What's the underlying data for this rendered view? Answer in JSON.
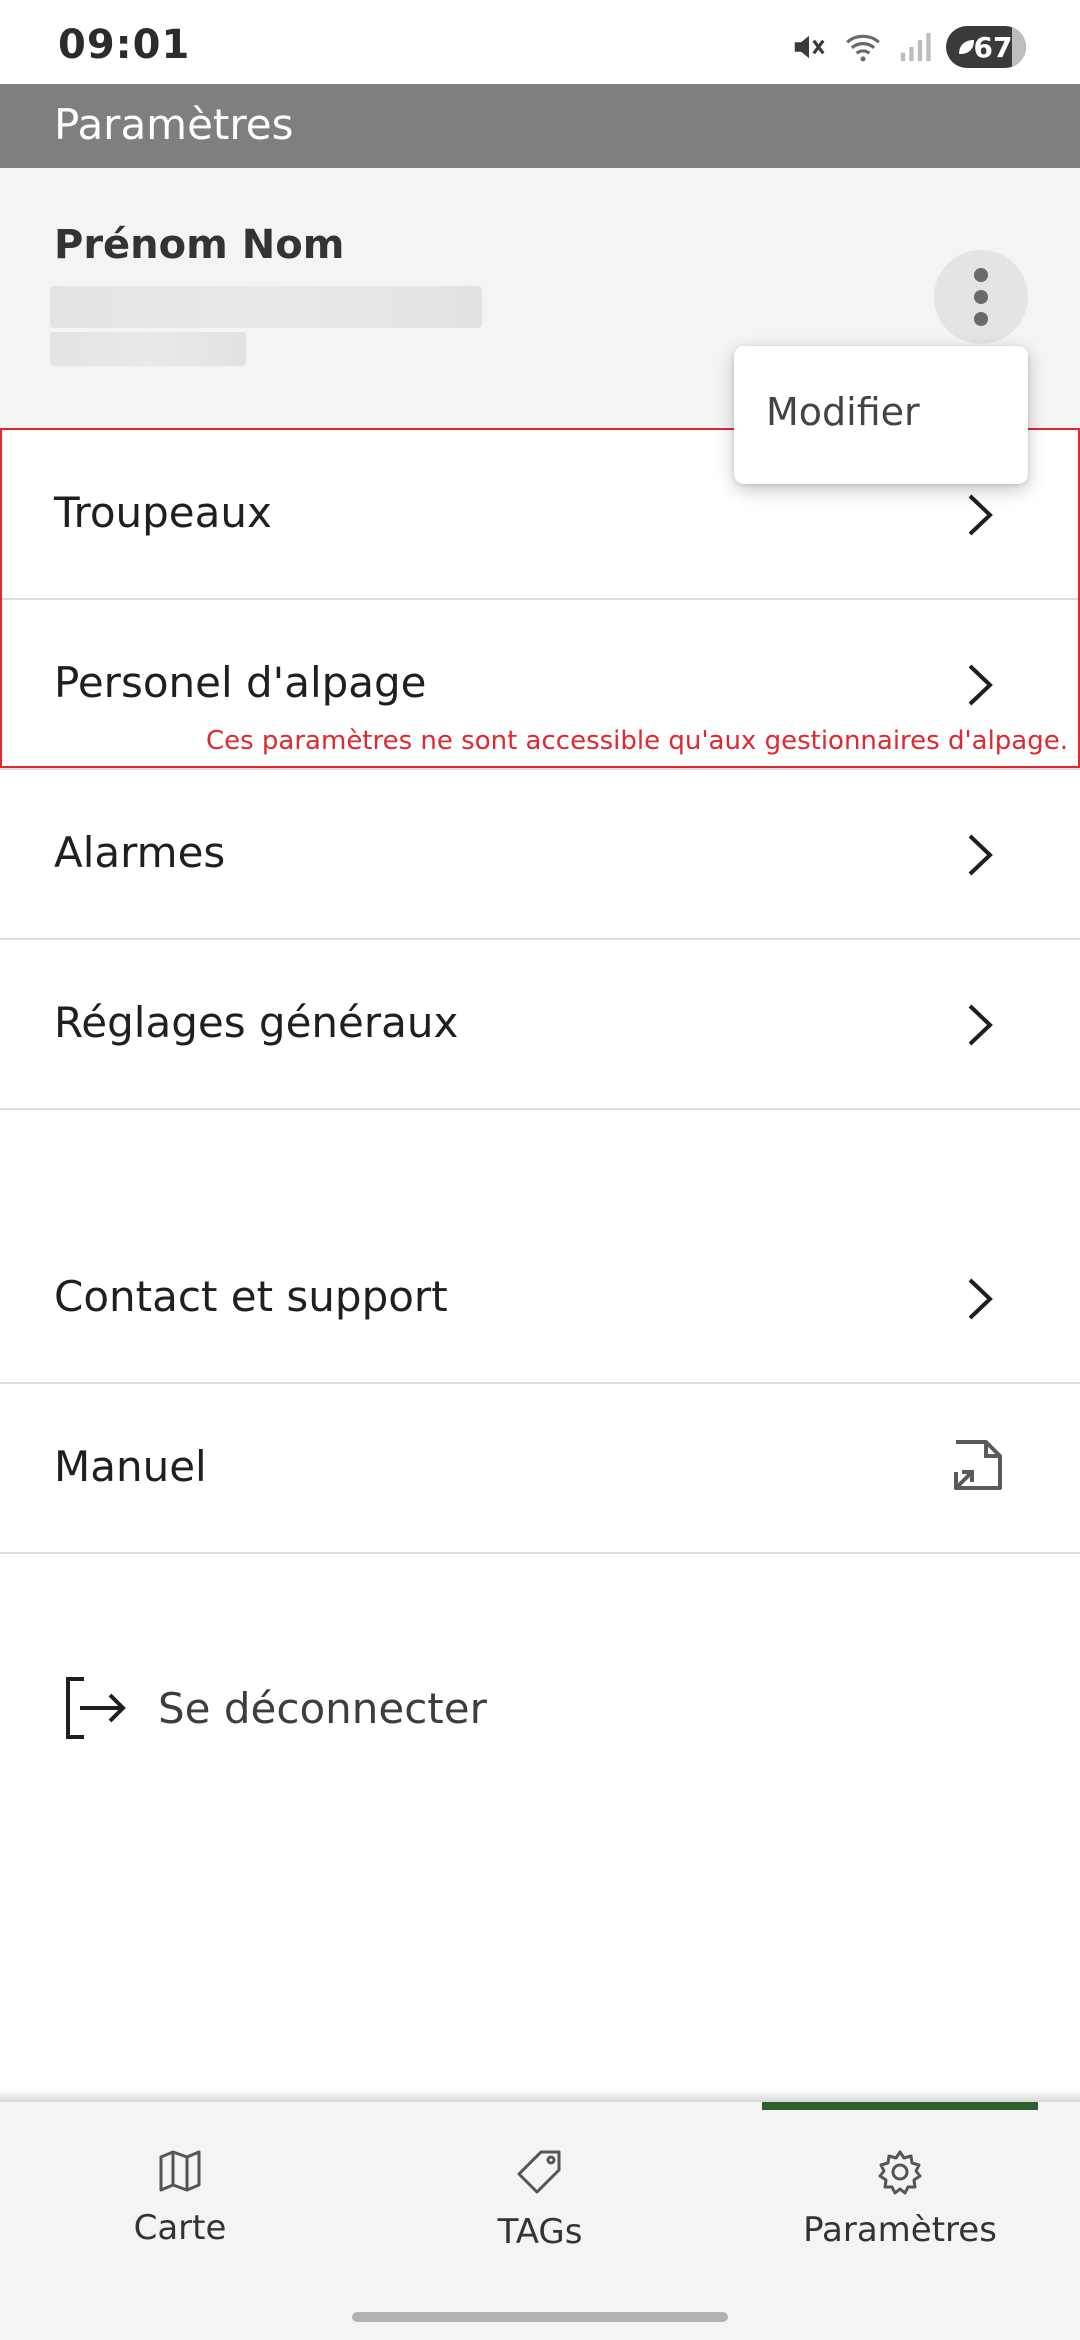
{
  "status_bar": {
    "time": "09:01",
    "battery_level": "67",
    "icons": [
      "mute-icon",
      "wifi-icon",
      "signal-icon",
      "battery-icon"
    ]
  },
  "app_bar": {
    "title": "Paramètres"
  },
  "profile": {
    "name": "Prénom Nom"
  },
  "popup_menu": {
    "items": [
      "Modifier"
    ]
  },
  "menu": {
    "items": [
      {
        "label": "Troupeaux",
        "icon": "chevron-right-icon"
      },
      {
        "label": "Personel d'alpage",
        "icon": "chevron-right-icon"
      },
      {
        "label": "Alarmes",
        "icon": "chevron-right-icon"
      },
      {
        "label": "Réglages généraux",
        "icon": "chevron-right-icon"
      },
      {
        "label": "Contact et support",
        "icon": "chevron-right-icon"
      },
      {
        "label": "Manuel",
        "icon": "external-document-icon"
      }
    ],
    "restricted_note": "Ces paramètres ne sont accessible qu'aux gestionnaires d'alpage."
  },
  "logout": {
    "label": "Se déconnecter"
  },
  "bottom_nav": {
    "items": [
      {
        "label": "Carte",
        "icon": "map-icon"
      },
      {
        "label": "TAGs",
        "icon": "tag-icon"
      },
      {
        "label": "Paramètres",
        "icon": "gear-icon"
      }
    ],
    "active_index": 2
  },
  "colors": {
    "app_bar": "#7f7f7f",
    "accent_green": "#2c5f2e",
    "warning_red": "#e0282e"
  }
}
